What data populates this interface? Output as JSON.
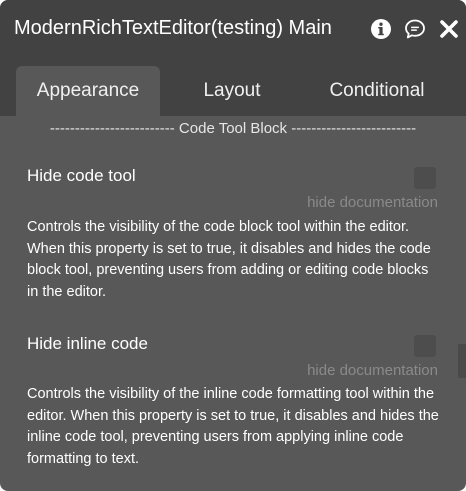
{
  "window": {
    "title": "ModernRichTextEditor(testing) Main"
  },
  "tabs": [
    {
      "label": "Appearance",
      "active": true
    },
    {
      "label": "Layout",
      "active": false
    },
    {
      "label": "Conditional",
      "active": false
    }
  ],
  "section": {
    "header": "------------------------- Code Tool Block -------------------------"
  },
  "properties": [
    {
      "label": "Hide code tool",
      "checked": false,
      "doc_link": "hide documentation",
      "description": "Controls the visibility of the code block tool within the editor. When this property is set to true, it disables and hides the code block tool, preventing users from adding or editing code blocks in the editor."
    },
    {
      "label": "Hide inline code",
      "checked": false,
      "doc_link": "hide documentation",
      "description": "Controls the visibility of the inline code formatting tool within the editor. When this property is set to true, it disables and hides the inline code tool, preventing users from applying inline code formatting to text."
    }
  ],
  "icons": {
    "info": "info-icon",
    "comment": "comment-icon",
    "close": "close-icon"
  },
  "colors": {
    "panel_bg": "#585858",
    "header_bg": "#424242",
    "text": "#ffffff",
    "muted_text": "#8a8a8a",
    "checkbox": "#4d4d4d"
  }
}
